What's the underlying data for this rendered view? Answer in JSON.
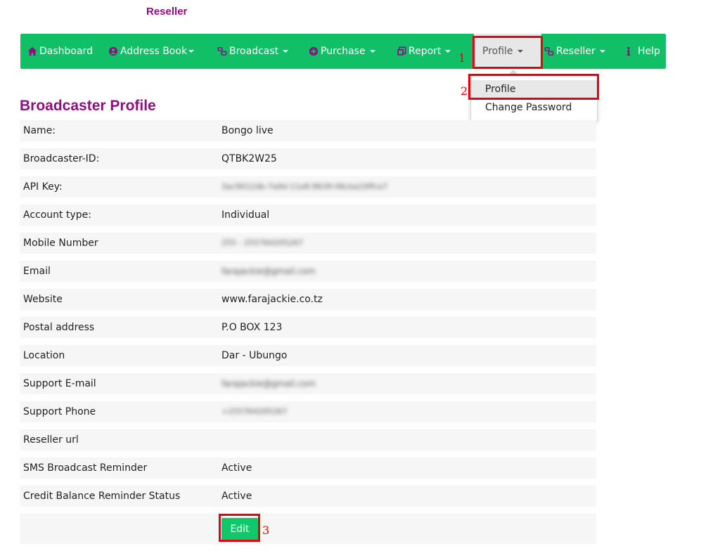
{
  "brand": "Reseller",
  "nav": {
    "dashboard": "Dashboard",
    "address_book": "Address Book",
    "broadcast": "Broadcast",
    "purchase": "Purchase",
    "report": "Report",
    "profile": "Profile",
    "reseller": "Reseller",
    "help": "Help"
  },
  "dropdown": {
    "profile": "Profile",
    "change_password": "Change Password"
  },
  "annotations": [
    "1",
    "2",
    "3"
  ],
  "page_title": "Broadcaster Profile",
  "rows": [
    {
      "label": "Name:",
      "value": "Bongo live"
    },
    {
      "label": "Broadcaster-ID:",
      "value": "QTBK2W25"
    },
    {
      "label": "API Key:",
      "value": "3ac9012db-7a9d-11e8-8639-06cba10ffce7"
    },
    {
      "label": "Account type:",
      "value": "Individual"
    },
    {
      "label": "Mobile Number",
      "value": "255 - 255764205267"
    },
    {
      "label": "Email",
      "value": "farajackie@gmail.com"
    },
    {
      "label": "Website",
      "value": "www.farajackie.co.tz"
    },
    {
      "label": "Postal address",
      "value": "P.O BOX 123"
    },
    {
      "label": "Location",
      "value": "Dar - Ubungo"
    },
    {
      "label": "Support E-mail",
      "value": "farajackie@gmail.com"
    },
    {
      "label": "Support Phone",
      "value": "+255764205267"
    },
    {
      "label": "Reseller url",
      "value": ""
    },
    {
      "label": "SMS Broadcast Reminder",
      "value": "Active"
    },
    {
      "label": "Credit Balance Reminder Status",
      "value": "Active"
    }
  ],
  "edit_label": "Edit",
  "colors": {
    "nav_green": "#10bf66",
    "brand_purple": "#8e0f7e",
    "highlight_red": "#e8000b"
  }
}
